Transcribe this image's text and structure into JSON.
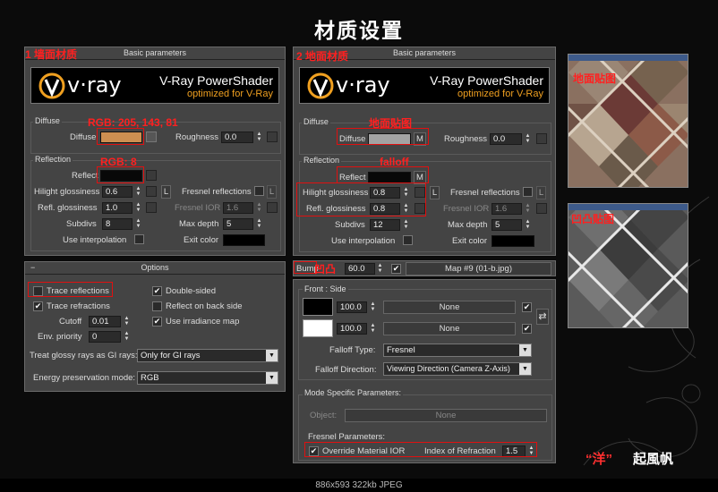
{
  "title": "材质设置",
  "brand": {
    "quote": "“洋”",
    "name": "起風帆"
  },
  "status_bar": "886x593  322kb  JPEG",
  "left_panel": {
    "rollout_title": "Basic parameters",
    "logo_brand": "v·ray",
    "logo_line1": "V-Ray PowerShader",
    "logo_line2": "optimized for V-Ray",
    "diffuse_group": "Diffuse",
    "diffuse_label": "Diffuse",
    "roughness_label": "Roughness",
    "roughness_value": "0.0",
    "reflection_group": "Reflection",
    "reflect_label": "Reflect",
    "hilight_label": "Hilight glossiness",
    "hilight_value": "0.6",
    "refl_gloss_label": "Refl. glossiness",
    "refl_gloss_value": "1.0",
    "subdivs_label": "Subdivs",
    "subdivs_value": "8",
    "use_interp_label": "Use interpolation",
    "fresnel_label": "Fresnel reflections",
    "fresnel_ior_label": "Fresnel IOR",
    "fresnel_ior_value": "1.6",
    "max_depth_label": "Max depth",
    "max_depth_value": "5",
    "exit_color_label": "Exit color",
    "l_button": "L"
  },
  "options_panel": {
    "rollout_title": "Options",
    "collapse_symbol": "−",
    "trace_reflections": "Trace reflections",
    "trace_refractions": "Trace refractions",
    "cutoff_label": "Cutoff",
    "cutoff_value": "0.01",
    "env_priority_label": "Env. priority",
    "env_priority_value": "0",
    "double_sided": "Double-sided",
    "reflect_on_back": "Reflect on back side",
    "use_irradiance": "Use irradiance map",
    "glossy_label": "Treat glossy rays as GI rays:",
    "glossy_value": "Only for GI rays",
    "energy_label": "Energy preservation mode:",
    "energy_value": "RGB"
  },
  "right_panel": {
    "rollout_title": "Basic parameters",
    "logo_brand": "v·ray",
    "logo_line1": "V-Ray PowerShader",
    "logo_line2": "optimized for V-Ray",
    "diffuse_group": "Diffuse",
    "diffuse_label": "Diffuse",
    "m_button": "M",
    "roughness_label": "Roughness",
    "roughness_value": "0.0",
    "reflection_group": "Reflection",
    "reflect_label": "Reflect",
    "hilight_label": "Hilight glossiness",
    "hilight_value": "0.8",
    "refl_gloss_label": "Refl. glossiness",
    "refl_gloss_value": "0.8",
    "subdivs_label": "Subdivs",
    "subdivs_value": "12",
    "use_interp_label": "Use interpolation",
    "fresnel_label": "Fresnel reflections",
    "fresnel_ior_label": "Fresnel IOR",
    "fresnel_ior_value": "1.6",
    "max_depth_label": "Max depth",
    "max_depth_value": "5",
    "exit_color_label": "Exit color",
    "l_button": "L"
  },
  "bump_row": {
    "label": "Bump",
    "value": "60.0",
    "map": "Map #9 (01-b.jpg)"
  },
  "falloff_panel": {
    "front_side": "Front : Side",
    "value1": "100.0",
    "value2": "100.0",
    "none1": "None",
    "none2": "None",
    "swap_icon": "⇄",
    "falloff_type_label": "Falloff Type:",
    "falloff_type_value": "Fresnel",
    "falloff_dir_label": "Falloff Direction:",
    "falloff_dir_value": "Viewing Direction (Camera Z-Axis)",
    "mode_specific": "Mode Specific Parameters:",
    "object_label": "Object:",
    "object_value": "None",
    "fresnel_params": "Fresnel Parameters:",
    "override_ior": "Override Material IOR",
    "ior_label": "Index of Refraction",
    "ior_value": "1.5"
  },
  "annotations": {
    "wall_material": "1  墙面材质",
    "floor_material": "2  地面材质",
    "rgb_diffuse": "RGB: 205, 143, 81",
    "rgb_reflect": "RGB: 8",
    "floor_texture": "地面贴图",
    "falloff": "falloff",
    "bump_cn": "凹凸",
    "floor_map_photo": "地面贴图",
    "bump_map_photo": "凹凸贴图"
  },
  "colors": {
    "diffuse_swatch": "#cd8f51",
    "right_diffuse_swatch": "#a3a3a3",
    "annotation": "#ff2020"
  }
}
